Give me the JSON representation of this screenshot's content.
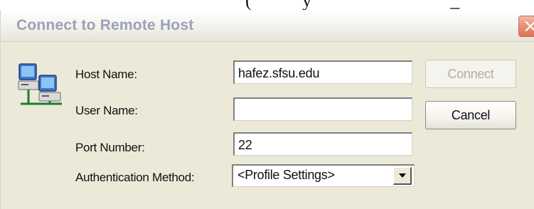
{
  "background_text": "(           y                              _",
  "dialog": {
    "title": "Connect to Remote Host",
    "close_symbol": "×"
  },
  "form": {
    "host_name_label": "Host Name:",
    "host_name_value": "hafez.sfsu.edu",
    "user_name_label": "User Name:",
    "user_name_value": "",
    "port_number_label": "Port Number:",
    "port_number_value": "22",
    "auth_method_label": "Authentication Method:",
    "auth_method_value": "<Profile Settings>"
  },
  "buttons": {
    "connect_label": "Connect",
    "cancel_label": "Cancel"
  },
  "icons": {
    "dialog_icon": "network-computers-icon",
    "close": "close-icon",
    "dropdown": "chevron-down-icon"
  },
  "colors": {
    "dialog_bg": "#ece9d8",
    "title_text": "#9aa2b8",
    "close_button": "#e88d72",
    "disabled_text": "#b0ad9f"
  }
}
